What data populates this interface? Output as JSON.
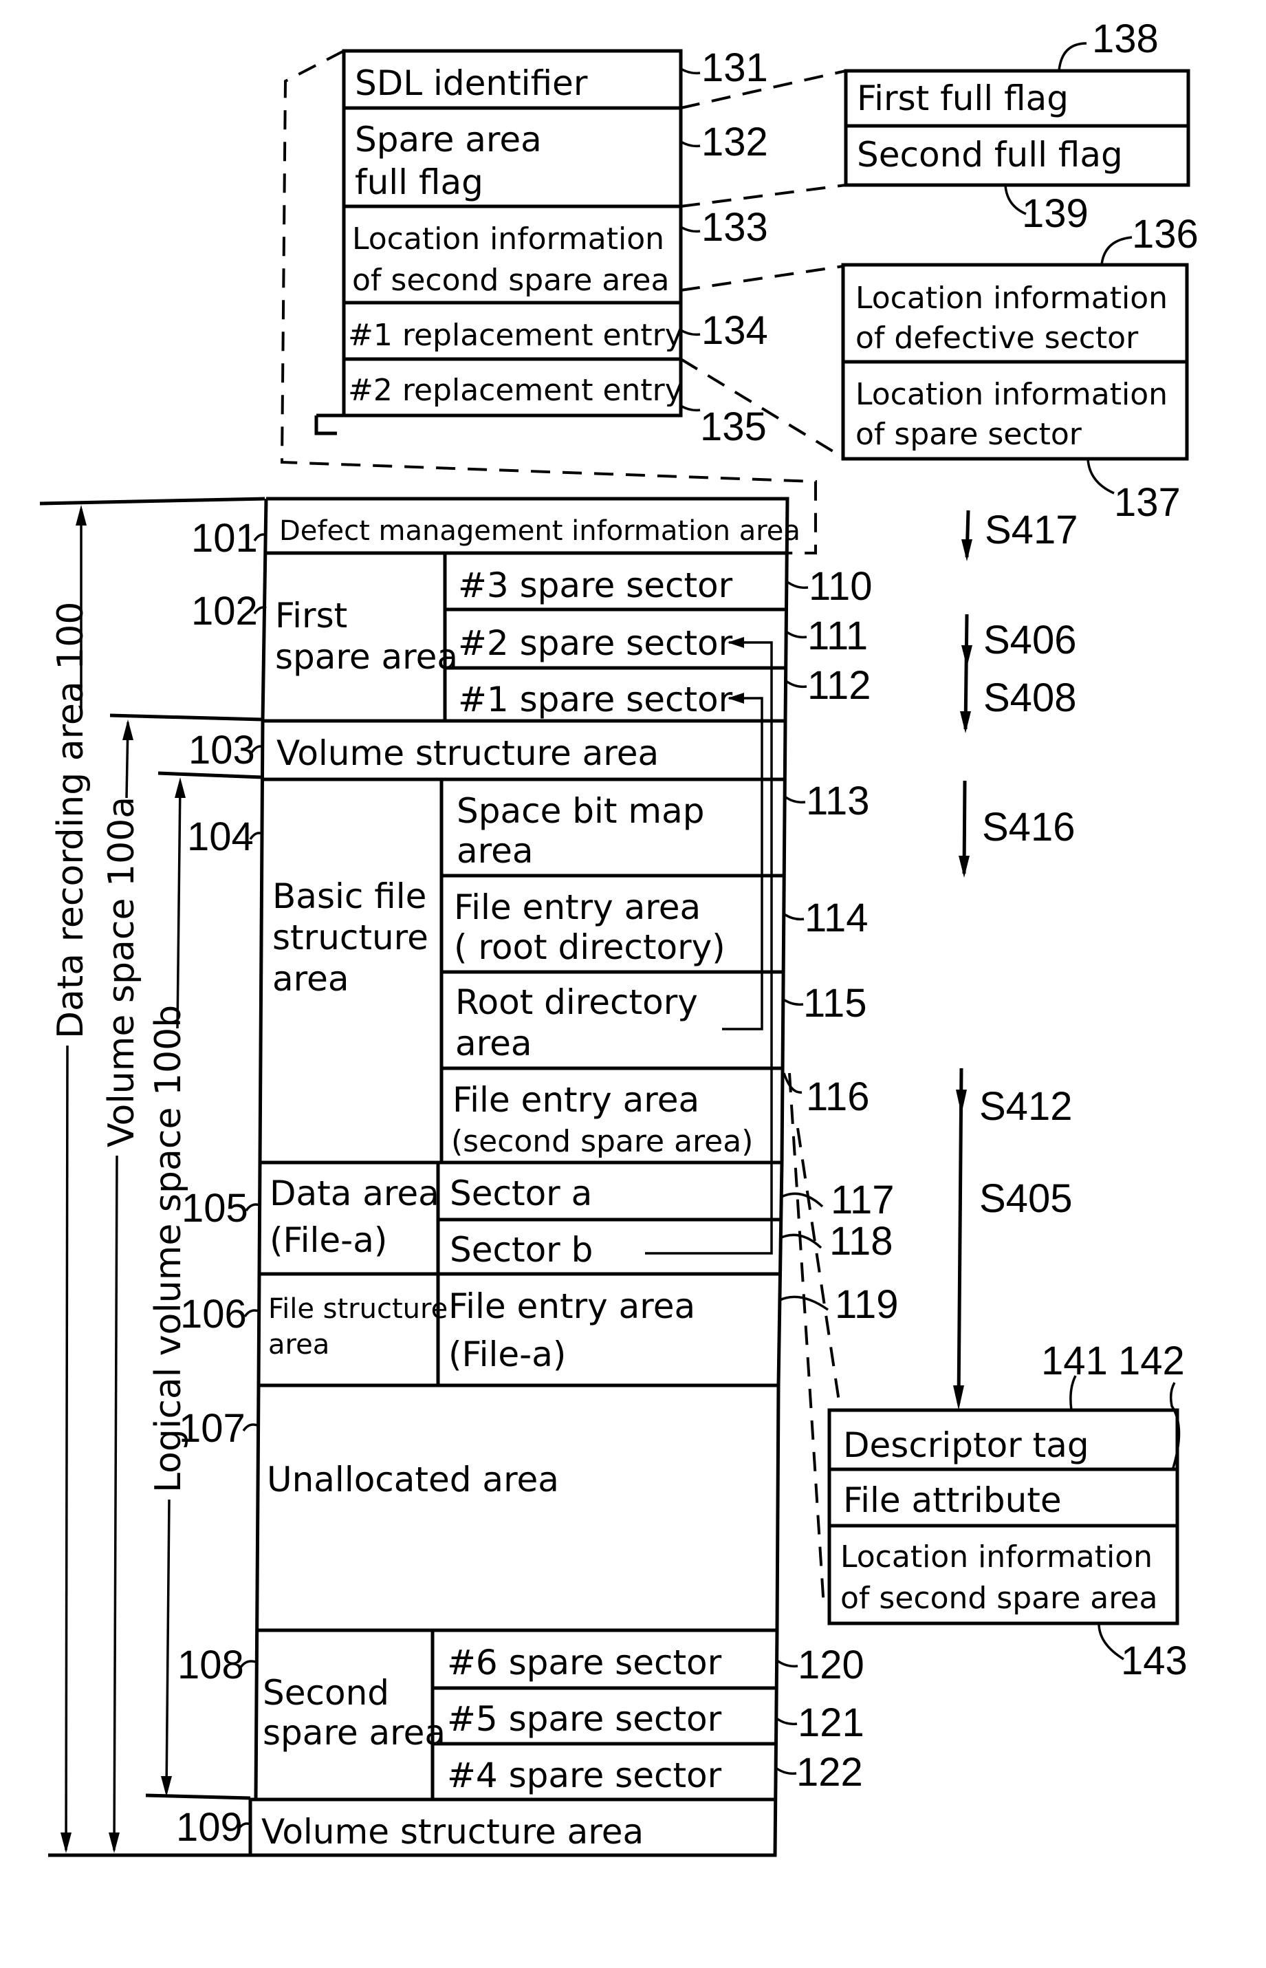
{
  "diagram": {
    "sdl_table": {
      "rows": [
        {
          "ref": "131",
          "lines": [
            "SDL identifier"
          ]
        },
        {
          "ref": "132",
          "lines": [
            "Spare area",
            "full flag"
          ]
        },
        {
          "ref": "133",
          "lines": [
            "Location information",
            "of second spare area"
          ]
        },
        {
          "ref": "134",
          "lines": [
            "#1 replacement entry"
          ]
        },
        {
          "ref": "135",
          "lines": [
            "#2 replacement entry"
          ]
        }
      ]
    },
    "flag_table": {
      "top_ref": "138",
      "bottom_ref": "139",
      "rows": [
        "First full flag",
        "Second full flag"
      ]
    },
    "entry_table": {
      "top_ref": "136",
      "bottom_ref": "137",
      "rows": [
        [
          "Location information",
          "of defective sector"
        ],
        [
          "Location information",
          "of spare sector"
        ]
      ]
    },
    "descriptor_table": {
      "refs": [
        "141",
        "142"
      ],
      "bottom_ref": "143",
      "rows": [
        [
          "Descriptor tag"
        ],
        [
          "File attribute"
        ],
        [
          "Location information",
          "of second spare area"
        ]
      ]
    },
    "main_areas": [
      {
        "ref": "101",
        "lines": [
          "Defect management information area"
        ]
      },
      {
        "ref": "102",
        "lines": [
          "First",
          "spare area"
        ],
        "sub": [
          {
            "ref": "110",
            "lines": [
              "#3 spare sector"
            ]
          },
          {
            "ref": "111",
            "lines": [
              "#2 spare sector"
            ]
          },
          {
            "ref": "112",
            "lines": [
              "#1 spare sector"
            ]
          }
        ]
      },
      {
        "ref": "103",
        "lines": [
          "Volume structure area"
        ]
      },
      {
        "ref": "104",
        "lines": [
          "Basic file",
          "structure",
          "area"
        ],
        "sub": [
          {
            "ref": "113",
            "lines": [
              "Space bit map",
              "area"
            ]
          },
          {
            "ref": "114",
            "lines": [
              "File entry area",
              "( root directory)"
            ]
          },
          {
            "ref": "115",
            "lines": [
              "Root directory",
              "area"
            ]
          },
          {
            "ref": "116",
            "lines": [
              "File entry area",
              "(second spare area)"
            ]
          }
        ]
      },
      {
        "ref": "105",
        "lines": [
          "Data area",
          "(File-a)"
        ],
        "sub": [
          {
            "ref": "117",
            "lines": [
              "Sector a"
            ]
          },
          {
            "ref": "118",
            "lines": [
              "Sector b"
            ]
          }
        ]
      },
      {
        "ref": "106",
        "lines": [
          "File structure",
          "area"
        ],
        "sub": [
          {
            "ref": "119",
            "lines": [
              "File entry area",
              "(File-a)"
            ]
          }
        ]
      },
      {
        "ref": "107",
        "lines": [
          "Unallocated area"
        ]
      },
      {
        "ref": "108",
        "lines": [
          "Second",
          "spare area"
        ],
        "sub": [
          {
            "ref": "120",
            "lines": [
              "#6 spare sector"
            ]
          },
          {
            "ref": "121",
            "lines": [
              "#5 spare sector"
            ]
          },
          {
            "ref": "122",
            "lines": [
              "#4 spare sector"
            ]
          }
        ]
      },
      {
        "ref": "109",
        "lines": [
          "Volume structure area"
        ]
      }
    ],
    "spans": {
      "data_recording_area": "Data recording area 100",
      "volume_space": "Volume space 100a",
      "logical_volume_space": "Logical volume space 100b"
    },
    "steps": [
      "S417",
      "S406",
      "S408",
      "S416",
      "S412",
      "S405"
    ]
  }
}
